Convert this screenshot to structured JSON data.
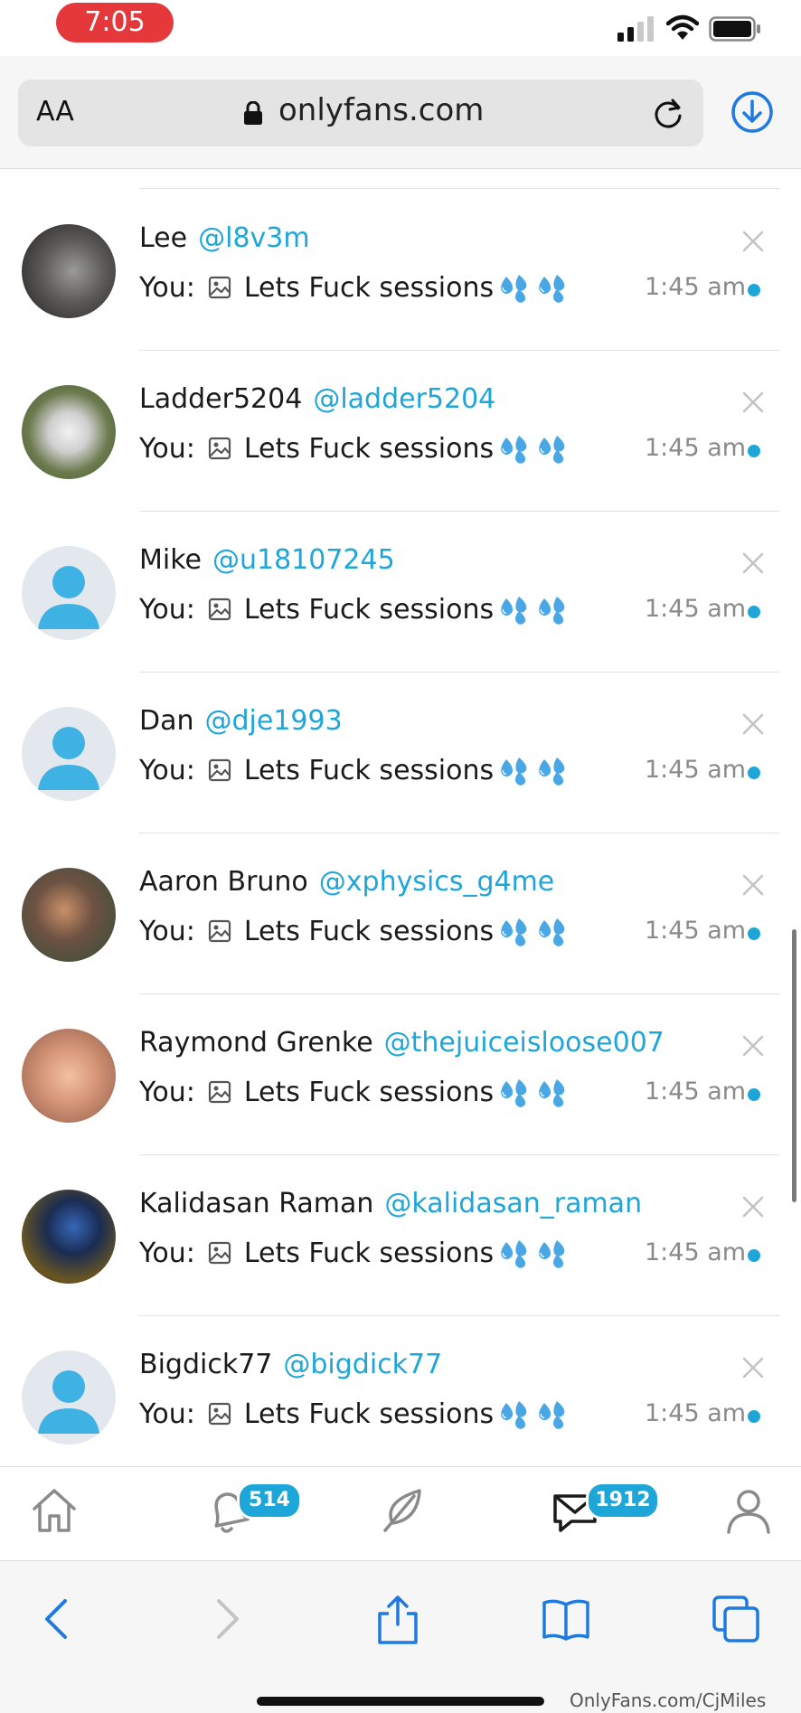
{
  "status_bar": {
    "time": "7:05"
  },
  "browser": {
    "text_size_label": "AA",
    "url": "onlyfans.com"
  },
  "chats": [
    {
      "name": "Lee",
      "handle": "@l8v3m",
      "prefix": "You:",
      "message": "Lets Fuck sessions",
      "time": "1:45 am",
      "avatar": "photo"
    },
    {
      "name": "Ladder5204",
      "handle": "@ladder5204",
      "prefix": "You:",
      "message": "Lets Fuck sessions",
      "time": "1:45 am",
      "avatar": "photo"
    },
    {
      "name": "Mike",
      "handle": "@u18107245",
      "prefix": "You:",
      "message": "Lets Fuck sessions",
      "time": "1:45 am",
      "avatar": "default"
    },
    {
      "name": "Dan",
      "handle": "@dje1993",
      "prefix": "You:",
      "message": "Lets Fuck sessions",
      "time": "1:45 am",
      "avatar": "default"
    },
    {
      "name": "Aaron Bruno",
      "handle": "@xphysics_g4me",
      "prefix": "You:",
      "message": "Lets Fuck sessions",
      "time": "1:45 am",
      "avatar": "photo"
    },
    {
      "name": "Raymond Grenke",
      "handle": "@thejuiceisloose007",
      "prefix": "You:",
      "message": "Lets Fuck sessions",
      "time": "1:45 am",
      "avatar": "photo"
    },
    {
      "name": "Kalidasan Raman",
      "handle": "@kalidasan_raman",
      "prefix": "You:",
      "message": "Lets Fuck sessions",
      "time": "1:45 am",
      "avatar": "photo"
    },
    {
      "name": "Bigdick77",
      "handle": "@bigdick77",
      "prefix": "You:",
      "message": "Lets Fuck sessions",
      "time": "1:45 am",
      "avatar": "default"
    }
  ],
  "tab_bar": {
    "items": [
      "home-icon",
      "bell-icon",
      "feather-icon",
      "messages-icon",
      "profile-icon"
    ],
    "notifications_badge": "514",
    "messages_badge": "1912"
  },
  "safari_toolbar": {
    "items": [
      "back-icon",
      "forward-icon",
      "share-icon",
      "bookmarks-icon",
      "tabs-icon"
    ]
  },
  "watermark": "OnlyFans.com/CjMiles",
  "colors": {
    "accent": "#1fa6d8",
    "time_pill": "#e5383b"
  }
}
